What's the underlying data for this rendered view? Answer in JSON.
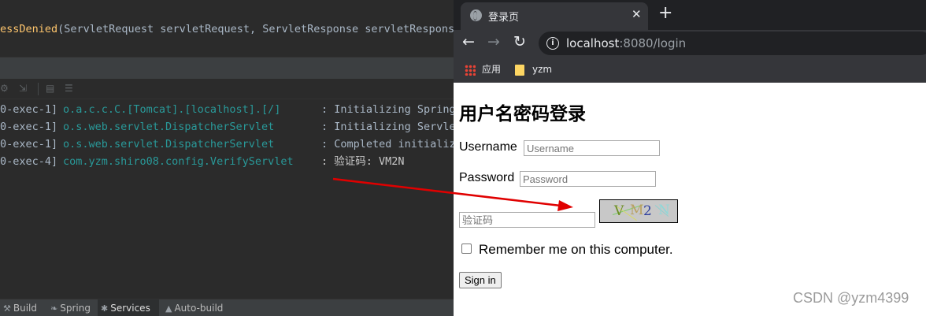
{
  "ide": {
    "code": {
      "method": "essDenied",
      "params": "(ServletRequest servletRequest, ServletResponse servletResponse"
    },
    "log": [
      {
        "thread": "0-exec-1]",
        "logger": "o.a.c.c.C.[Tomcat].[localhost].[/]",
        "message": ": Initializing Spring"
      },
      {
        "thread": "0-exec-1]",
        "logger": "o.s.web.servlet.DispatcherServlet",
        "message": ": Initializing Servle"
      },
      {
        "thread": "0-exec-1]",
        "logger": "o.s.web.servlet.DispatcherServlet",
        "message": ": Completed initializ"
      },
      {
        "thread": "0-exec-4]",
        "logger": "com.yzm.shiro08.config.VerifyServlet",
        "message": ": 验证码: VM2N"
      }
    ],
    "status_tabs": [
      {
        "label": "Build",
        "icon": "hammer-icon"
      },
      {
        "label": "Spring",
        "icon": "spring-leaf-icon"
      },
      {
        "label": "Services",
        "icon": "services-icon",
        "active": true
      },
      {
        "label": "Auto-build",
        "icon": "warning-icon"
      }
    ]
  },
  "browser": {
    "tab_title": "登录页",
    "url_host": "localhost",
    "url_rest": ":8080/login",
    "bookmarks": [
      {
        "label": "应用",
        "icon": "apps-grid-icon"
      },
      {
        "label": "yzm",
        "icon": "folder-icon"
      }
    ],
    "page": {
      "heading": "用户名密码登录",
      "username_label": "Username",
      "username_placeholder": "Username",
      "password_label": "Password",
      "password_placeholder": "Password",
      "captcha_placeholder": "验证码",
      "captcha_text": [
        "V",
        "M",
        "2",
        "N"
      ],
      "remember_label": "Remember me on this computer.",
      "remember_checked": false,
      "signin_label": "Sign in"
    }
  },
  "watermark": "CSDN @yzm4399",
  "colors": {
    "annotation_arrow": "#e00000",
    "log_class": "#299999",
    "method_name": "#ffc66d"
  }
}
